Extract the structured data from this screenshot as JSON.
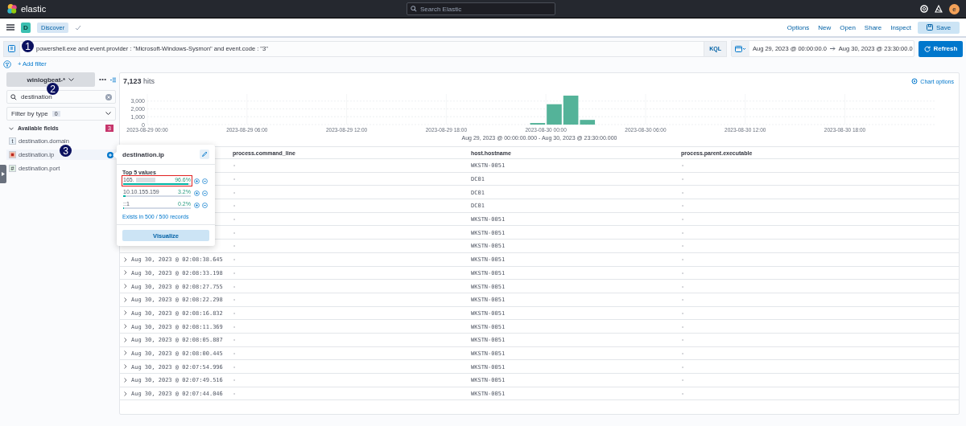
{
  "header": {
    "logo_text": "elastic",
    "search_placeholder": "Search Elastic",
    "avatar": "e"
  },
  "nav": {
    "app_badge": "D",
    "breadcrumb": "Discover",
    "links": [
      "Options",
      "New",
      "Open",
      "Share",
      "Inspect"
    ],
    "save_button": "Save"
  },
  "query_bar": {
    "value": "powershell.exe and event.provider : \"Microsoft-Windows-Sysmon\" and event.code : \"3\"",
    "language": "KQL",
    "date_start": "Aug 29, 2023 @ 00:00:00.0",
    "date_end": "Aug 30, 2023 @ 23:30:00.0",
    "refresh_button": "Refresh"
  },
  "add_filter": "+ Add filter",
  "sidebar": {
    "index_pattern": "winlogbeat-*",
    "search_value": "destination",
    "filter_by_type": "Filter by type",
    "filter_count": "0",
    "section_title": "Available fields",
    "section_count": "3",
    "expanded": true,
    "fields": [
      {
        "name": "destination.domain",
        "kind": "string",
        "glyph": "t",
        "selected": false
      },
      {
        "name": "destination.ip",
        "kind": "ip",
        "selected": true
      },
      {
        "name": "destination.port",
        "kind": "number",
        "glyph": "#",
        "selected": false
      }
    ]
  },
  "popover": {
    "title": "destination.ip",
    "subtitle": "Top 5 values",
    "values": [
      {
        "value": "165.",
        "redacted": true,
        "percent": "96.6%",
        "level": 0.966,
        "highlighted": true
      },
      {
        "value": "10.10.155.159",
        "redacted": false,
        "percent": "3.2%",
        "level": 0.032,
        "highlighted": false
      },
      {
        "value": "::1",
        "redacted": false,
        "percent": "0.2%",
        "level": 0.002,
        "highlighted": false
      }
    ],
    "exists": "Exists in 500 / 500 records",
    "button": "Visualize"
  },
  "hits": {
    "count": "7,123",
    "label": "hits"
  },
  "chart_options": "Chart options",
  "chart_data": {
    "type": "bar",
    "categories": [
      "2023-08-29 00:00",
      null,
      null,
      null,
      null,
      null,
      "2023-08-29 06:00",
      null,
      null,
      null,
      null,
      null,
      "2023-08-29 12:00",
      null,
      null,
      null,
      null,
      null,
      "2023-08-29 18:00",
      null,
      null,
      null,
      null,
      null,
      "2023-08-30 00:00",
      null,
      null,
      null,
      null,
      null,
      "2023-08-30 06:00",
      null,
      null,
      null,
      null,
      null,
      "2023-08-30 12:00",
      null,
      null,
      null,
      null,
      null,
      "2023-08-30 18:00",
      null,
      null,
      null,
      null,
      null
    ],
    "series": [
      {
        "color": "#54b399",
        "values": [
          null,
          null,
          null,
          null,
          null,
          null,
          null,
          null,
          null,
          null,
          null,
          null,
          null,
          null,
          null,
          null,
          null,
          null,
          null,
          null,
          null,
          null,
          null,
          200,
          2600,
          3700,
          600,
          null,
          null,
          null,
          null,
          null,
          null,
          null,
          null,
          null,
          null,
          null,
          null,
          null,
          null,
          null,
          null,
          null,
          null,
          null,
          null,
          null
        ]
      }
    ],
    "ylim": [
      0,
      3900
    ],
    "grid": true,
    "yticks": [
      0,
      {
        "value": 1000,
        "label": "1,000"
      },
      {
        "value": 2000,
        "label": "2,000"
      },
      {
        "value": 3000,
        "label": "3,000"
      }
    ]
  },
  "time_range": "Aug 29, 2023 @ 00:00:00.000 - Aug 30, 2023 @ 23:30:00.000",
  "table": {
    "columns": [
      "process.command_line",
      "host.hostname",
      "process.parent.executable"
    ],
    "rows": [
      {
        "cells": [
          "-",
          "WKSTN-0051",
          "-"
        ]
      },
      {
        "cells": [
          "-",
          "DC01",
          "-"
        ]
      },
      {
        "cells": [
          "-",
          "DC01",
          "-"
        ]
      },
      {
        "cells": [
          "-",
          "DC01",
          "-"
        ]
      },
      {
        "cells": [
          "-",
          "WKSTN-0051",
          "-"
        ]
      },
      {
        "cells": [
          "-",
          "WKSTN-0051",
          "-"
        ]
      },
      {
        "cells": [
          "-",
          "WKSTN-0051",
          "-"
        ]
      },
      {
        "time": "Aug 30, 2023 @ 02:08:38.645",
        "cells": [
          "-",
          "WKSTN-0051",
          "-"
        ]
      },
      {
        "time": "Aug 30, 2023 @ 02:08:33.198",
        "cells": [
          "-",
          "WKSTN-0051",
          "-"
        ]
      },
      {
        "time": "Aug 30, 2023 @ 02:08:27.755",
        "cells": [
          "-",
          "WKSTN-0051",
          "-"
        ]
      },
      {
        "time": "Aug 30, 2023 @ 02:08:22.298",
        "cells": [
          "-",
          "WKSTN-0051",
          "-"
        ]
      },
      {
        "time": "Aug 30, 2023 @ 02:08:16.832",
        "cells": [
          "-",
          "WKSTN-0051",
          "-"
        ]
      },
      {
        "time": "Aug 30, 2023 @ 02:08:11.369",
        "cells": [
          "-",
          "WKSTN-0051",
          "-"
        ]
      },
      {
        "time": "Aug 30, 2023 @ 02:08:05.887",
        "cells": [
          "-",
          "WKSTN-0051",
          "-"
        ]
      },
      {
        "time": "Aug 30, 2023 @ 02:08:00.445",
        "cells": [
          "-",
          "WKSTN-0051",
          "-"
        ]
      },
      {
        "time": "Aug 30, 2023 @ 02:07:54.996",
        "cells": [
          "-",
          "WKSTN-0051",
          "-"
        ]
      },
      {
        "time": "Aug 30, 2023 @ 02:07:49.516",
        "cells": [
          "-",
          "WKSTN-0051",
          "-"
        ]
      },
      {
        "time": "Aug 30, 2023 @ 02:07:44.046",
        "cells": [
          "-",
          "WKSTN-0051",
          "-"
        ]
      }
    ]
  },
  "annotations": [
    {
      "label": "1"
    },
    {
      "label": "2"
    },
    {
      "label": "3"
    }
  ]
}
